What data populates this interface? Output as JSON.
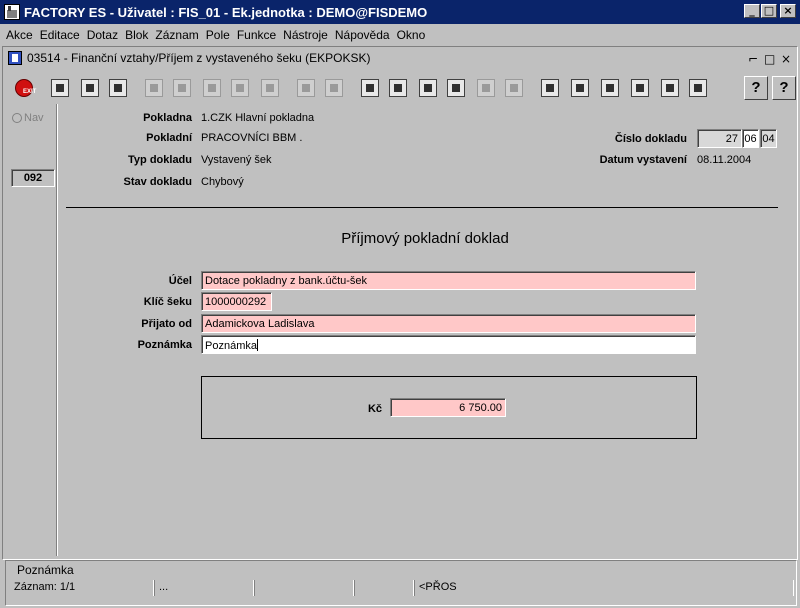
{
  "app": {
    "title": "FACTORY ES - Uživatel : FIS_01 - Ek.jednotka : DEMO@FISDEMO",
    "minimize": "_",
    "maximize": "□",
    "close": "×"
  },
  "menu": [
    "Akce",
    "Editace",
    "Dotaz",
    "Blok",
    "Záznam",
    "Pole",
    "Funkce",
    "Nástroje",
    "Nápověda",
    "Okno"
  ],
  "form_window": {
    "title": "03514 - Finanční vztahy/Příjem z vystaveného šeku (EKPOKSK)",
    "ctl_minimize": "⌐",
    "ctl_restore": "□",
    "ctl_close": "×"
  },
  "toolbar": {
    "exit_label": "EXIT",
    "help_label": "?",
    "whatsthis_label": "?"
  },
  "nav": {
    "label": "Nav",
    "record_number": "092"
  },
  "header": {
    "pokladna_label": "Pokladna",
    "pokladna_value": "1.CZK Hlavní pokladna",
    "pokladni_label": "Pokladní",
    "pokladni_value": "PRACOVNÍCI BBM .",
    "typ_label": "Typ dokladu",
    "typ_value": "Vystavený šek",
    "stav_label": "Stav dokladu",
    "stav_value": "Chybový",
    "cislo_label": "Číslo dokladu",
    "cislo_part1": "27",
    "cislo_part2": "06",
    "cislo_part3": "04",
    "datum_label": "Datum vystavení",
    "datum_value": "08.11.2004"
  },
  "form": {
    "title": "Příjmový pokladní doklad",
    "ucel_label": "Účel",
    "ucel_value": "Dotace pokladny z bank.účtu-šek",
    "klic_label": "Klíč šeku",
    "klic_value": "1000000292",
    "prijato_label": "Přijato od",
    "prijato_value": "Adamickova Ladislava",
    "poznamka_label": "Poznámka",
    "poznamka_value": "Poznámka",
    "kc_label": "Kč",
    "kc_value": "6 750.00"
  },
  "status": {
    "message": "Poznámka",
    "record": "Záznam: 1/1",
    "cell2": "...",
    "mode": "<PŘOS"
  },
  "colors": {
    "title_bar": "#0a246a",
    "window_bg": "#c0c0c0",
    "required_field": "#ffc8c8"
  }
}
